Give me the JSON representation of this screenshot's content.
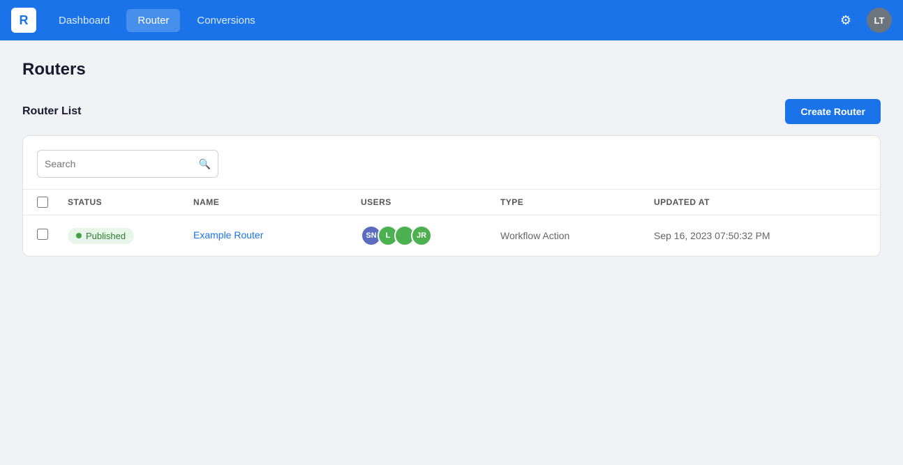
{
  "app": {
    "logo": "R",
    "logo_color": "#1a73e8"
  },
  "navbar": {
    "dashboard_label": "Dashboard",
    "router_label": "Router",
    "conversions_label": "Conversions",
    "active_tab": "router",
    "gear_icon": "⚙",
    "avatar_initials": "LT"
  },
  "page": {
    "title": "Routers",
    "section_title": "Router List",
    "create_button_label": "Create Router"
  },
  "search": {
    "placeholder": "Search"
  },
  "table": {
    "columns": [
      "STATUS",
      "NAME",
      "USERS",
      "TYPE",
      "UPDATED AT"
    ],
    "rows": [
      {
        "status": "Published",
        "status_type": "published",
        "name": "Example Router",
        "users": [
          {
            "initials": "SN",
            "color": "#5c6bc0"
          },
          {
            "initials": "L",
            "color": "#4caf50"
          },
          {
            "initials": "",
            "color": "#4caf50",
            "dot": true
          },
          {
            "initials": "JR",
            "color": "#4caf50"
          }
        ],
        "type": "Workflow Action",
        "updated_at": "Sep 16, 2023 07:50:32 PM"
      }
    ]
  }
}
